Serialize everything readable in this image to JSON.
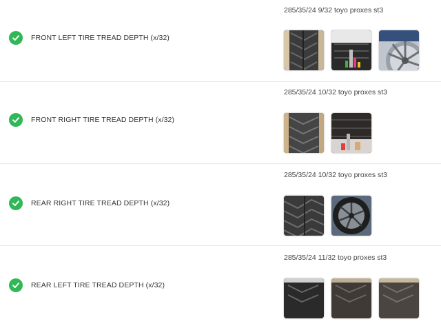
{
  "colors": {
    "check_green": "#2fb855",
    "divider": "#e6e6e6"
  },
  "rows": [
    {
      "label": "FRONT LEFT TIRE TREAD DEPTH (x/32)",
      "note": "285/35/24 9/32 toyo proxes st3",
      "photos": [
        "tread-photo",
        "tread-gauge-photo",
        "rim-photo"
      ]
    },
    {
      "label": "FRONT RIGHT TIRE TREAD DEPTH (x/32)",
      "note": "285/35/24 10/32 toyo proxes st3",
      "photos": [
        "tread-photo",
        "tread-gauge-photo"
      ]
    },
    {
      "label": "REAR RIGHT TIRE TREAD DEPTH (x/32)",
      "note": "285/35/24 10/32 toyo proxes st3",
      "photos": [
        "tread-photo",
        "rim-photo"
      ]
    },
    {
      "label": "REAR LEFT TIRE TREAD DEPTH (x/32)",
      "note": "285/35/24 11/32 toyo proxes st3",
      "photos": [
        "tread-photo",
        "tread-photo",
        "tread-photo"
      ]
    }
  ]
}
